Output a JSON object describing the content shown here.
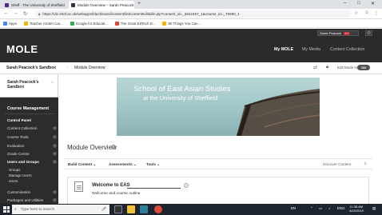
{
  "browser": {
    "tabs": [
      {
        "label": "Sheff - The University of Sheffield",
        "active": false
      },
      {
        "label": "Module Overview – Sarah Peacock",
        "active": true
      }
    ],
    "new_tab_glyph": "+",
    "url": "https://vle.shef.ac.uk/webapps/blackboard/content/listContentEditable.jsp?content_id=_3622457_1&course_id=_76690_1",
    "bookmarks": [
      {
        "label": "Apps",
        "color": "#4285f4"
      },
      {
        "label": "Teacher Center Car...",
        "color": "#f4b400"
      },
      {
        "label": "Google for Educati...",
        "color": "#34a853"
      },
      {
        "label": "The Great EdTech D...",
        "color": "#db4437"
      },
      {
        "label": "50 Things You Can...",
        "color": "#f4b400"
      }
    ]
  },
  "header": {
    "logo": "MOLE",
    "user_name": "Sarah Peacock",
    "notification_count": "41+",
    "nav_tabs": [
      "My MOLE",
      "My Media",
      "Content Collection"
    ]
  },
  "breadcrumb": {
    "course": "Sarah Peacock's Sandbox",
    "page": "Module Overview",
    "edit_mode_label": "Edit Mode is:",
    "edit_mode_value": "ON"
  },
  "sidebar": {
    "course_title": "Sarah Peacock's Sandbox",
    "section_title": "Course Management",
    "items": [
      {
        "label": "Control Panel",
        "bold": true
      },
      {
        "label": "Content Collection",
        "bold": false
      },
      {
        "label": "Course Tools",
        "bold": false
      },
      {
        "label": "Evaluation",
        "bold": false
      },
      {
        "label": "Grade Centre",
        "bold": false
      },
      {
        "label": "Users and Groups",
        "bold": true
      }
    ],
    "sub_items": [
      "Groups",
      "Manage Users",
      "Users"
    ],
    "lower_items": [
      "Customisation",
      "Packages and Utilities"
    ]
  },
  "main": {
    "banner": {
      "line1": "School of East Asian Studies",
      "line2": "at the University of Sheffield"
    },
    "heading": "Module Overview",
    "actions": [
      "Build Content",
      "Assessments",
      "Tools"
    ],
    "discover": "Discover Content",
    "item": {
      "title": "Welcome to EAS",
      "description": "Welcome and course outline"
    }
  },
  "taskbar": {
    "search_placeholder": "Type here to search",
    "language": "ENG",
    "time": "11:38 AM",
    "date": "4/24/2019",
    "tray_lang": "EN"
  },
  "colors": {
    "header_bg": "#2b2b2b",
    "sidebar_bg": "#2c2c2c",
    "badge_red": "#c21f2b",
    "banner_teal": "#9fc5c6"
  }
}
